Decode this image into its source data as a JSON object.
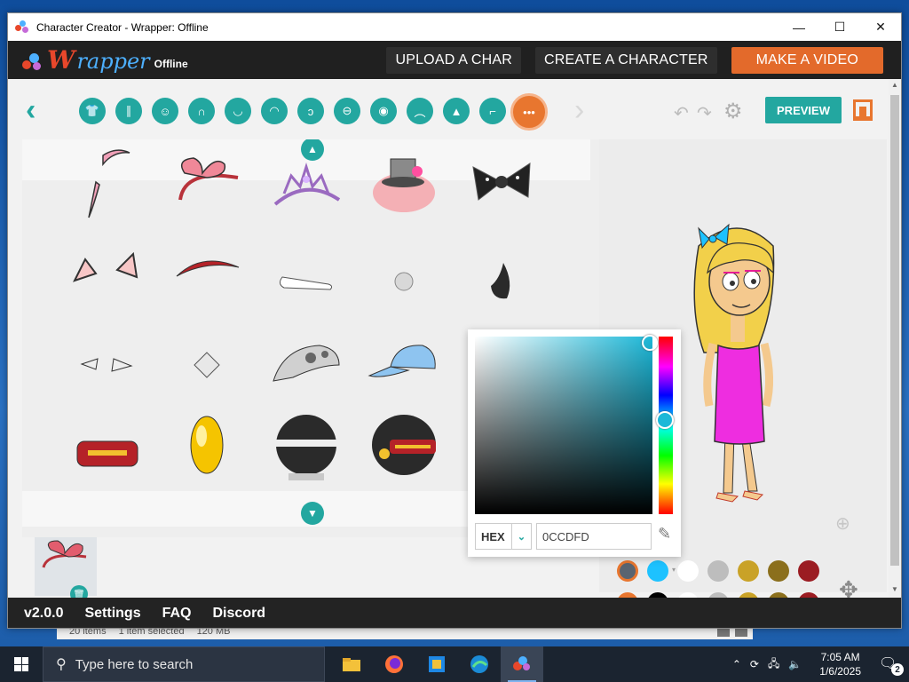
{
  "window": {
    "title": "Character Creator - Wrapper: Offline",
    "minimize": "—",
    "maximize": "☐",
    "close": "✕"
  },
  "header": {
    "logo_w": "W",
    "logo_rest": "rapper",
    "logo_offline": "Offline",
    "buttons": [
      "UPLOAD A CHAR",
      "CREATE A CHARACTER",
      "MAKE A VIDEO"
    ]
  },
  "toolbar": {
    "back": "‹",
    "forward": "›",
    "preview_label": "PREVIEW",
    "categories": [
      {
        "name": "shirt",
        "glyph": "👕"
      },
      {
        "name": "pants",
        "glyph": "∥"
      },
      {
        "name": "face-shape",
        "glyph": "☺"
      },
      {
        "name": "hair",
        "glyph": "∩"
      },
      {
        "name": "beard",
        "glyph": "◡"
      },
      {
        "name": "lips",
        "glyph": "◠"
      },
      {
        "name": "ear",
        "glyph": "ↄ"
      },
      {
        "name": "forehead",
        "glyph": "⊖"
      },
      {
        "name": "eye",
        "glyph": "◉"
      },
      {
        "name": "eyebrow",
        "glyph": "︵"
      },
      {
        "name": "nose",
        "glyph": "▲"
      },
      {
        "name": "glasses",
        "glyph": "⌐"
      },
      {
        "name": "accessory",
        "glyph": "•••"
      }
    ]
  },
  "color_picker": {
    "format_label": "HEX",
    "hex_value": "0CCDFD"
  },
  "swatches": {
    "row1": [
      "#5a6470",
      "#1dc2ff",
      "#ffffff",
      "#bdbdbd",
      "#c9a227",
      "#8b6f1c",
      "#9b1c22"
    ],
    "row2": [
      "#e8762f",
      "#000000",
      "#ffffff",
      "#bdbdbd",
      "#c9a227",
      "#8b6f1c",
      "#9b1c22"
    ]
  },
  "footer": {
    "version": "v2.0.0",
    "settings": "Settings",
    "faq": "FAQ",
    "discord": "Discord"
  },
  "explorer_status": {
    "items": "20 items",
    "selected": "1 item selected",
    "size": "120 MB"
  },
  "taskbar": {
    "search_placeholder": "Type here to search",
    "time": "7:05 AM",
    "date": "1/6/2025",
    "notifications": "2"
  },
  "colors": {
    "accent_teal": "#23a7a0",
    "accent_orange": "#e8762f",
    "header_bg": "#202020"
  }
}
